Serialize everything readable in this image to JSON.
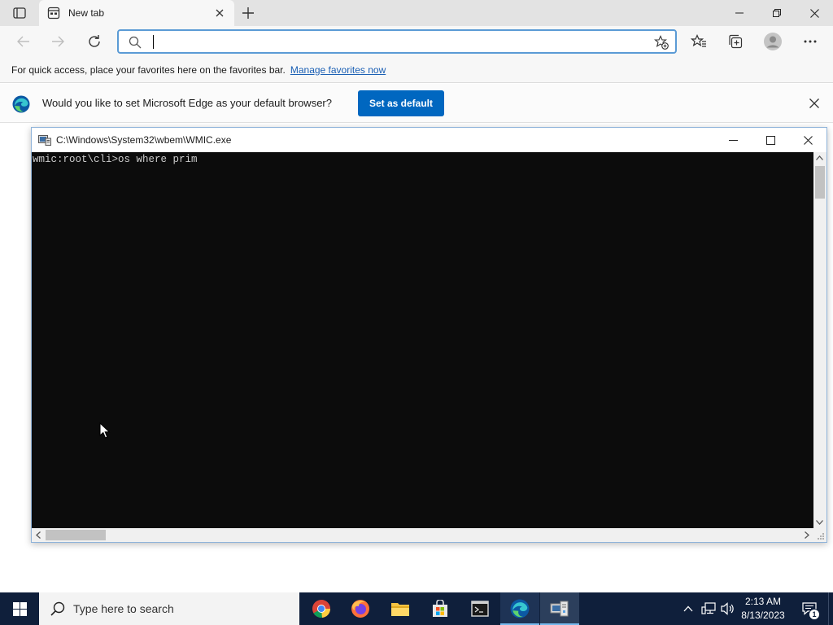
{
  "browser": {
    "tab": {
      "title": "New tab"
    },
    "address_bar": {
      "value": "",
      "placeholder": ""
    },
    "favorites_bar": {
      "text": "For quick access, place your favorites here on the favorites bar.",
      "link": "Manage favorites now"
    },
    "infobar": {
      "text": "Would you like to set Microsoft Edge as your default browser?",
      "button": "Set as default"
    }
  },
  "console": {
    "title": "C:\\Windows\\System32\\wbem\\WMIC.exe",
    "line": "wmic:root\\cli>os where prim"
  },
  "taskbar": {
    "search_placeholder": "Type here to search",
    "apps": [
      "chrome-icon",
      "firefox-icon",
      "file-explorer-icon",
      "store-icon",
      "terminal-icon",
      "edge-icon",
      "wmic-icon"
    ],
    "clock": {
      "time": "2:13 AM",
      "date": "8/13/2023"
    },
    "notification_count": "1"
  },
  "colors": {
    "edge_accent": "#0067c0",
    "taskbar": "#0f1f3b",
    "console_bg": "#0c0c0c",
    "console_fg": "#cccccc",
    "link": "#1a5fb4"
  }
}
